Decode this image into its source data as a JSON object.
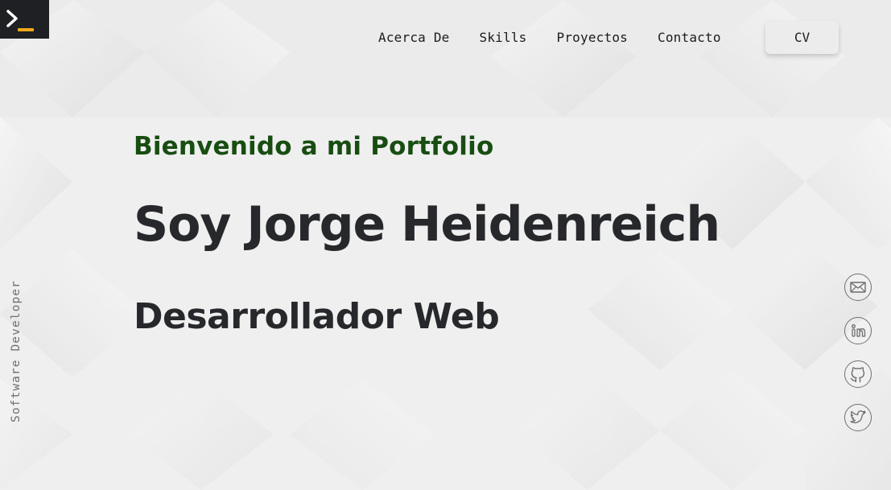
{
  "logo": {
    "icon": "terminal-prompt-icon",
    "accent_color": "#f1a81c"
  },
  "nav": {
    "items": [
      {
        "label": "Acerca De"
      },
      {
        "label": "Skills"
      },
      {
        "label": "Proyectos"
      },
      {
        "label": "Contacto"
      }
    ],
    "cv_label": "CV"
  },
  "hero": {
    "welcome": "Bienvenido a mi Portfolio",
    "name": "Soy Jorge Heidenreich",
    "role": "Desarrollador Web"
  },
  "sidebar": {
    "vertical_label": "Software Developer"
  },
  "social": [
    {
      "icon": "mail-icon"
    },
    {
      "icon": "linkedin-icon"
    },
    {
      "icon": "github-icon"
    },
    {
      "icon": "twitter-icon"
    }
  ],
  "colors": {
    "welcome": "#184d12",
    "heading": "#27282c",
    "background": "#efefef"
  }
}
